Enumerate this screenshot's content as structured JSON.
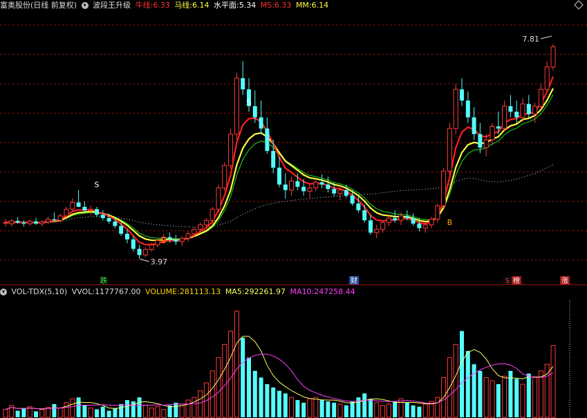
{
  "header": {
    "stock_title": "富奥股份(日线 前复权)",
    "indicator_name": "波段王升级",
    "niu_label": "牛线:",
    "niu_value": "6.33",
    "ma_label": "马线:",
    "ma_value": "6.14",
    "level_label": "水平面:",
    "level_value": "5.34",
    "ms_label": "MS:",
    "ms_value": "6.33",
    "mm_label": "MM:",
    "mm_value": "6.14"
  },
  "vol_header": {
    "name": "VOL-TDX(5,10)",
    "vvol_label": "VVOL:",
    "vvol_value": "1177767.00",
    "volume_label": "VOLUME:",
    "volume_value": "281113.13",
    "ma5_label": "MA5:",
    "ma5_value": "292261.97",
    "ma10_label": "MA10:",
    "ma10_value": "247258.44"
  },
  "annotations": {
    "high_label": "7.81",
    "low_label": "3.97",
    "s_label": "S",
    "b_label": "B",
    "event_die": "跌",
    "event_cai": "财",
    "event_s": "S",
    "event_bang": "榜",
    "event_zhang": "涨"
  },
  "colors": {
    "up": "#ff3c3c",
    "down": "#54fcfc",
    "niu_line": "#ff2020",
    "ma_line": "#ffff40",
    "thin_green": "#20e020",
    "dotted": "#d8d8d8",
    "grid": "#8a1010",
    "ma5": "#ffff60",
    "ma10": "#ff40ff"
  },
  "chart_data": [
    {
      "type": "candlestick",
      "title": "富奥股份(日线 前复权)",
      "ylim": [
        3.7,
        8.3
      ],
      "series": [
        {
          "name": "牛线",
          "last": 6.33
        },
        {
          "name": "马线",
          "last": 6.14
        },
        {
          "name": "水平面",
          "last": 5.34
        }
      ],
      "candles": [
        [
          4.62,
          4.68,
          4.55,
          4.62
        ],
        [
          4.6,
          4.68,
          4.55,
          4.65
        ],
        [
          4.65,
          4.72,
          4.6,
          4.62
        ],
        [
          4.62,
          4.66,
          4.55,
          4.6
        ],
        [
          4.6,
          4.68,
          4.56,
          4.64
        ],
        [
          4.64,
          4.7,
          4.58,
          4.6
        ],
        [
          4.6,
          4.66,
          4.55,
          4.63
        ],
        [
          4.63,
          4.72,
          4.6,
          4.68
        ],
        [
          4.68,
          4.8,
          4.64,
          4.66
        ],
        [
          4.66,
          4.78,
          4.62,
          4.74
        ],
        [
          4.74,
          4.9,
          4.7,
          4.86
        ],
        [
          4.86,
          5.05,
          4.82,
          4.98
        ],
        [
          4.98,
          5.2,
          4.93,
          4.9
        ],
        [
          4.9,
          5.0,
          4.8,
          4.84
        ],
        [
          4.84,
          4.92,
          4.75,
          4.86
        ],
        [
          4.86,
          4.9,
          4.72,
          4.76
        ],
        [
          4.76,
          4.84,
          4.66,
          4.7
        ],
        [
          4.7,
          4.78,
          4.6,
          4.64
        ],
        [
          4.64,
          4.72,
          4.52,
          4.56
        ],
        [
          4.56,
          4.62,
          4.38,
          4.42
        ],
        [
          4.42,
          4.5,
          4.25,
          4.32
        ],
        [
          4.32,
          4.38,
          4.1,
          4.15
        ],
        [
          4.15,
          4.22,
          3.97,
          4.04
        ],
        [
          4.04,
          4.18,
          4.0,
          4.14
        ],
        [
          4.14,
          4.26,
          4.1,
          4.22
        ],
        [
          4.22,
          4.34,
          4.18,
          4.3
        ],
        [
          4.3,
          4.42,
          4.24,
          4.36
        ],
        [
          4.36,
          4.44,
          4.26,
          4.32
        ],
        [
          4.32,
          4.4,
          4.22,
          4.28
        ],
        [
          4.28,
          4.38,
          4.2,
          4.34
        ],
        [
          4.34,
          4.46,
          4.28,
          4.42
        ],
        [
          4.42,
          4.54,
          4.36,
          4.5
        ],
        [
          4.5,
          4.62,
          4.44,
          4.58
        ],
        [
          4.58,
          4.7,
          4.52,
          4.66
        ],
        [
          4.66,
          4.9,
          4.6,
          4.86
        ],
        [
          4.86,
          5.3,
          4.8,
          5.24
        ],
        [
          5.24,
          5.7,
          5.18,
          5.64
        ],
        [
          5.64,
          6.3,
          5.58,
          6.2
        ],
        [
          6.2,
          7.3,
          6.1,
          7.2
        ],
        [
          7.2,
          7.5,
          6.9,
          7.0
        ],
        [
          7.0,
          7.2,
          6.6,
          6.7
        ],
        [
          6.7,
          6.98,
          6.4,
          6.5
        ],
        [
          6.5,
          6.8,
          6.2,
          6.3
        ],
        [
          6.3,
          6.5,
          5.85,
          5.9
        ],
        [
          5.9,
          6.1,
          5.5,
          5.6
        ],
        [
          5.6,
          5.8,
          5.25,
          5.3
        ],
        [
          5.3,
          5.5,
          5.05,
          5.2
        ],
        [
          5.2,
          5.44,
          5.1,
          5.36
        ],
        [
          5.36,
          5.5,
          5.2,
          5.26
        ],
        [
          5.26,
          5.4,
          5.1,
          5.18
        ],
        [
          5.18,
          5.32,
          5.05,
          5.24
        ],
        [
          5.24,
          5.4,
          5.18,
          5.34
        ],
        [
          5.34,
          5.48,
          5.24,
          5.3
        ],
        [
          5.3,
          5.44,
          5.16,
          5.22
        ],
        [
          5.22,
          5.34,
          5.08,
          5.14
        ],
        [
          5.14,
          5.28,
          5.02,
          5.2
        ],
        [
          5.2,
          5.3,
          5.06,
          5.1
        ],
        [
          5.1,
          5.2,
          4.92,
          4.96
        ],
        [
          4.96,
          5.08,
          4.8,
          4.84
        ],
        [
          4.84,
          4.94,
          4.62,
          4.66
        ],
        [
          4.66,
          4.76,
          4.4,
          4.44
        ],
        [
          4.44,
          4.58,
          4.34,
          4.5
        ],
        [
          4.5,
          4.66,
          4.44,
          4.62
        ],
        [
          4.62,
          4.76,
          4.56,
          4.7
        ],
        [
          4.7,
          4.84,
          4.62,
          4.66
        ],
        [
          4.66,
          4.8,
          4.58,
          4.74
        ],
        [
          4.74,
          4.84,
          4.66,
          4.7
        ],
        [
          4.7,
          4.78,
          4.56,
          4.6
        ],
        [
          4.6,
          4.7,
          4.46,
          4.52
        ],
        [
          4.52,
          4.64,
          4.44,
          4.58
        ],
        [
          4.58,
          4.72,
          4.52,
          4.68
        ],
        [
          4.68,
          4.96,
          4.62,
          4.92
        ],
        [
          4.92,
          5.6,
          4.88,
          5.54
        ],
        [
          5.54,
          6.4,
          5.48,
          6.3
        ],
        [
          6.3,
          7.1,
          6.2,
          7.0
        ],
        [
          7.0,
          7.2,
          6.7,
          6.8
        ],
        [
          6.8,
          6.96,
          6.4,
          6.5
        ],
        [
          6.5,
          6.68,
          6.1,
          6.2
        ],
        [
          6.2,
          6.4,
          5.86,
          5.96
        ],
        [
          5.96,
          6.2,
          5.8,
          6.1
        ],
        [
          6.1,
          6.4,
          6.0,
          6.34
        ],
        [
          6.34,
          6.6,
          6.2,
          6.3
        ],
        [
          6.3,
          6.8,
          6.24,
          6.7
        ],
        [
          6.7,
          6.9,
          6.5,
          6.6
        ],
        [
          6.6,
          6.8,
          6.4,
          6.5
        ],
        [
          6.5,
          6.84,
          6.42,
          6.74
        ],
        [
          6.74,
          6.9,
          6.5,
          6.56
        ],
        [
          6.56,
          6.76,
          6.4,
          6.7
        ],
        [
          6.7,
          7.1,
          6.64,
          7.0
        ],
        [
          7.0,
          7.5,
          6.96,
          7.4
        ],
        [
          7.4,
          7.81,
          7.34,
          7.76
        ]
      ]
    },
    {
      "type": "bar",
      "title": "VOL-TDX(5,10)",
      "series": [
        {
          "name": "VOLUME",
          "last": 281113.13
        },
        {
          "name": "MA5",
          "last": 292261.97
        },
        {
          "name": "MA10",
          "last": 247258.44
        }
      ],
      "volumes": [
        12,
        18,
        10,
        14,
        16,
        9,
        12,
        15,
        20,
        14,
        22,
        28,
        30,
        18,
        14,
        12,
        16,
        10,
        14,
        20,
        26,
        24,
        30,
        18,
        14,
        16,
        12,
        18,
        22,
        20,
        26,
        30,
        40,
        52,
        70,
        90,
        110,
        130,
        160,
        120,
        90,
        70,
        60,
        50,
        45,
        40,
        36,
        30,
        26,
        22,
        28,
        30,
        26,
        24,
        22,
        20,
        18,
        24,
        30,
        36,
        28,
        22,
        18,
        20,
        24,
        28,
        22,
        18,
        16,
        20,
        24,
        30,
        60,
        90,
        110,
        130,
        100,
        80,
        70,
        60,
        55,
        50,
        62,
        70,
        58,
        50,
        66,
        60,
        70,
        80,
        108
      ]
    }
  ]
}
